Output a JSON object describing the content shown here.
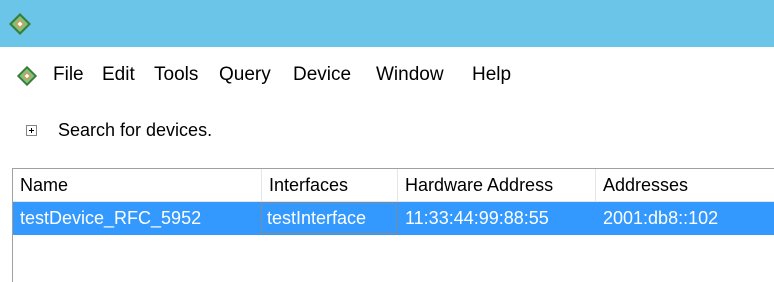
{
  "menubar": {
    "items": [
      "File",
      "Edit",
      "Tools",
      "Query",
      "Device",
      "Window",
      "Help"
    ]
  },
  "toolbar": {
    "search_label": "Search for devices."
  },
  "table": {
    "columns": [
      "Name",
      "Interfaces",
      "Hardware Address",
      "Addresses"
    ],
    "rows": [
      [
        "testDevice_RFC_5952",
        "testInterface",
        "11:33:44:99:88:55",
        "2001:db8::102"
      ]
    ]
  },
  "icons": {
    "app": "diamond-app-icon",
    "expander": "plus-expander-icon"
  },
  "colors": {
    "titlebar": "#6ac5e9",
    "selection": "#3399ff",
    "icon_outer": "#3a7c3a",
    "icon_inner": "#c8a060"
  }
}
